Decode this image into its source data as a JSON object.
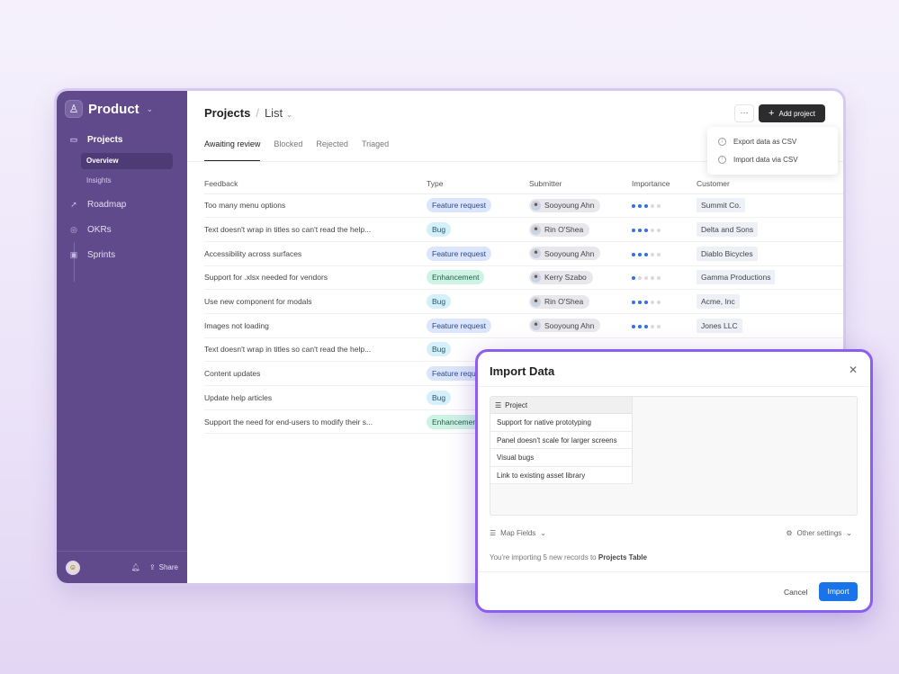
{
  "sidebar": {
    "workspace": "Product",
    "items": [
      {
        "label": "Projects",
        "icon": "message-square-icon"
      },
      {
        "label": "Roadmap",
        "icon": "rocket-icon"
      },
      {
        "label": "OKRs",
        "icon": "target-icon"
      },
      {
        "label": "Sprints",
        "icon": "calendar-icon"
      }
    ],
    "subitems": [
      {
        "label": "Overview",
        "active": true
      },
      {
        "label": "Insights",
        "active": false
      }
    ],
    "footer": {
      "share_label": "Share"
    }
  },
  "header": {
    "title": "Projects",
    "separator": "/",
    "view": "List",
    "more_label": "···",
    "add_label": "Add project"
  },
  "menu": {
    "items": [
      {
        "label": "Export data as CSV",
        "icon": "download-icon"
      },
      {
        "label": "Import data via CSV",
        "icon": "upload-icon"
      }
    ]
  },
  "tabs": [
    {
      "label": "Awaiting review",
      "active": true
    },
    {
      "label": "Blocked"
    },
    {
      "label": "Rejected"
    },
    {
      "label": "Triaged"
    }
  ],
  "table": {
    "columns": [
      "Feedback",
      "Type",
      "Submitter",
      "Importance",
      "Customer"
    ],
    "rows": [
      {
        "feedback": "Too many menu options",
        "type": "Feature request",
        "submitter": "Sooyoung Ahn",
        "importance": 3,
        "customer": "Summit Co."
      },
      {
        "feedback": "Text doesn't wrap in titles so can't read the help...",
        "type": "Bug",
        "submitter": "Rin O'Shea",
        "importance": 3,
        "customer": "Delta and Sons"
      },
      {
        "feedback": "Accessibility across surfaces",
        "type": "Feature request",
        "submitter": "Sooyoung Ahn",
        "importance": 3,
        "customer": "Diablo Bicycles"
      },
      {
        "feedback": "Support for .xlsx needed for vendors",
        "type": "Enhancement",
        "submitter": "Kerry Szabo",
        "importance": 1,
        "customer": "Gamma Productions"
      },
      {
        "feedback": "Use new component for modals",
        "type": "Bug",
        "submitter": "Rin O'Shea",
        "importance": 3,
        "customer": "Acme, Inc"
      },
      {
        "feedback": "Images not loading",
        "type": "Feature request",
        "submitter": "Sooyoung Ahn",
        "importance": 3,
        "customer": "Jones LLC"
      },
      {
        "feedback": "Text doesn't wrap in titles so can't read the help...",
        "type": "Bug"
      },
      {
        "feedback": "Content updates",
        "type": "Feature request"
      },
      {
        "feedback": "Update help articles",
        "type": "Bug"
      },
      {
        "feedback": "Support the need for end-users to modify their s...",
        "type": "Enhancement"
      }
    ]
  },
  "type_colors": {
    "Feature request": [
      "#dbe5fb",
      "#2d4a8a"
    ],
    "Bug": [
      "#d6f0fb",
      "#23556e"
    ],
    "Enhancement": [
      "#cdf3e4",
      "#1f5e47"
    ]
  },
  "importance_colors": {
    "on": "#2f6fe8",
    "off": "#d9d9de"
  },
  "modal": {
    "title": "Import Data",
    "column_header": "Project",
    "records": [
      "Support for native prototyping",
      "Panel doesn't scale for larger screens",
      "Visual bugs",
      "Link to existing asset library"
    ],
    "map_fields": "Map Fields",
    "other_settings": "Other settings",
    "note_prefix": "You're importing 5 new records to ",
    "note_target": "Projects Table",
    "cancel_label": "Cancel",
    "import_label": "Import",
    "accent": "#1a73e8"
  }
}
